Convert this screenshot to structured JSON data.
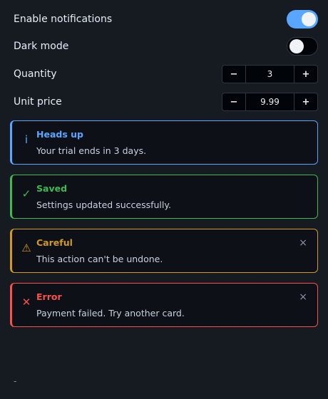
{
  "settings": {
    "notifications": {
      "label": "Enable notifications",
      "on": true
    },
    "dark_mode": {
      "label": "Dark mode",
      "on": false
    },
    "quantity": {
      "label": "Quantity",
      "value": "3",
      "minus": "−",
      "plus": "+"
    },
    "unit_price": {
      "label": "Unit price",
      "value": "9.99",
      "minus": "−",
      "plus": "+"
    }
  },
  "alerts": [
    {
      "variant": "info",
      "icon": "info-icon",
      "glyph": "i",
      "title": "Heads up",
      "message": "Your trial ends in 3 days.",
      "color": "#58a6ff",
      "dismissible": false
    },
    {
      "variant": "success",
      "icon": "check-icon",
      "glyph": "✓",
      "title": "Saved",
      "message": "Settings updated successfully.",
      "color": "#3fb950",
      "dismissible": false
    },
    {
      "variant": "warning",
      "icon": "warning-icon",
      "glyph": "⚠",
      "title": "Careful",
      "message": "This action can't be undone.",
      "color": "#d29922",
      "dismissible": true,
      "close": "×"
    },
    {
      "variant": "error",
      "icon": "error-icon",
      "glyph": "✕",
      "title": "Error",
      "message": "Payment failed. Try another card.",
      "color": "#f85149",
      "dismissible": true,
      "close": "×"
    }
  ],
  "footer": {
    "text": "-"
  }
}
